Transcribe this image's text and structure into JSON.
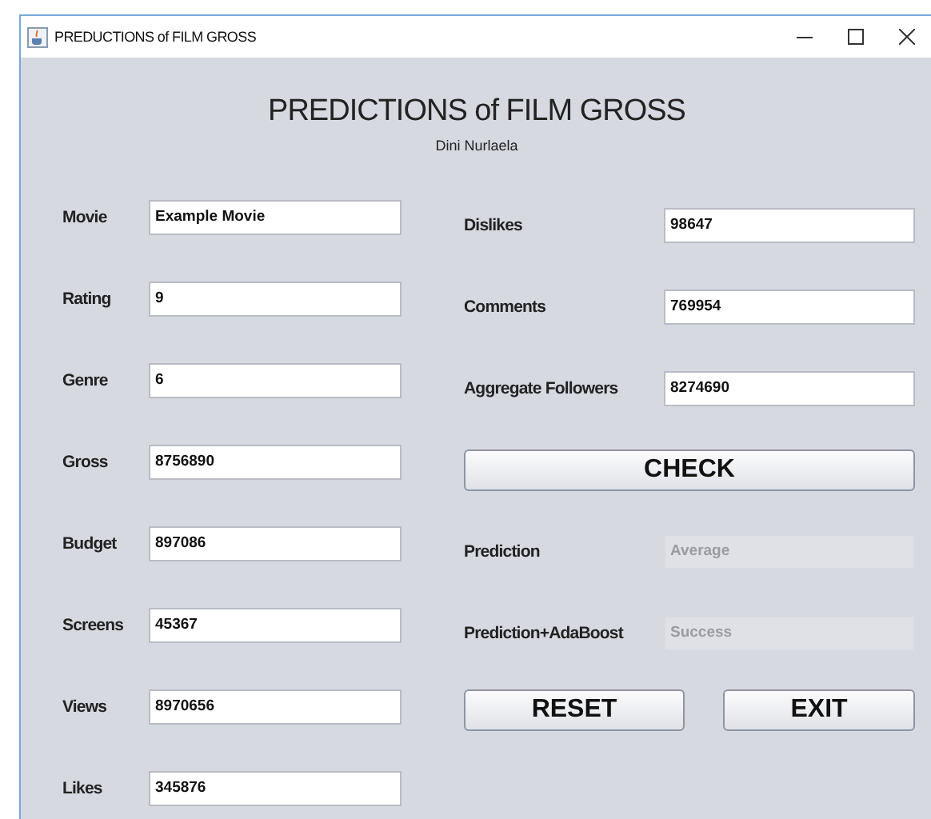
{
  "window": {
    "title": "PREDUCTIONS of FILM GROSS"
  },
  "header": {
    "title": "PREDICTIONS of FILM GROSS",
    "subtitle": "Dini Nurlaela"
  },
  "left_fields": [
    {
      "label": "Movie",
      "value": "Example Movie"
    },
    {
      "label": "Rating",
      "value": "9"
    },
    {
      "label": "Genre",
      "value": "6"
    },
    {
      "label": "Gross",
      "value": "8756890"
    },
    {
      "label": "Budget",
      "value": "897086"
    },
    {
      "label": "Screens",
      "value": "45367"
    },
    {
      "label": "Views",
      "value": "8970656"
    },
    {
      "label": "Likes",
      "value": "345876"
    }
  ],
  "right_items": [
    {
      "kind": "field",
      "label": "Dislikes",
      "value": "98647",
      "disabled": false
    },
    {
      "kind": "field",
      "label": "Comments",
      "value": "769954",
      "disabled": false
    },
    {
      "kind": "field",
      "label": "Aggregate Followers",
      "value": "8274690",
      "disabled": false
    },
    {
      "kind": "button",
      "label": "CHECK"
    },
    {
      "kind": "field",
      "label": "Prediction",
      "value": "Average",
      "disabled": true
    },
    {
      "kind": "field",
      "label": "Prediction+AdaBoost",
      "value": "Success",
      "disabled": true
    }
  ],
  "buttons": [
    "RESET",
    "EXIT"
  ]
}
